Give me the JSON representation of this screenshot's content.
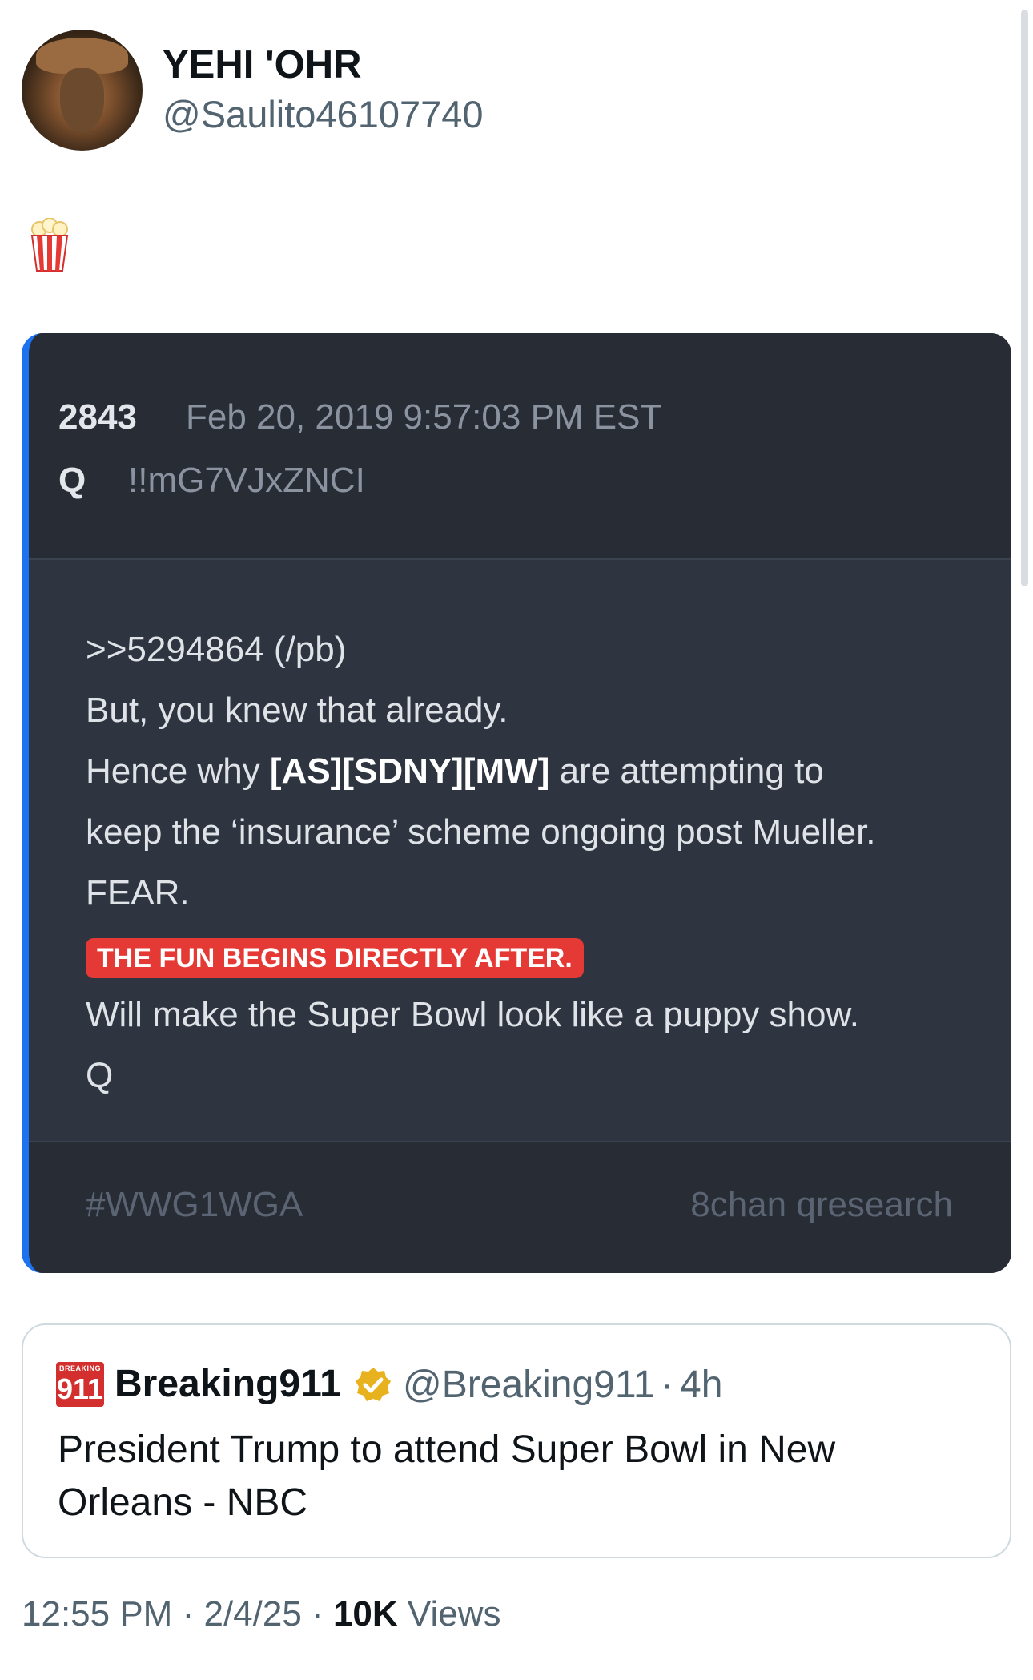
{
  "post": {
    "display_name": "YEHI 'OHR",
    "handle": "@Saulito46107740",
    "body_emoji": "popcorn"
  },
  "qcard": {
    "number": "2843",
    "date": "Feb 20, 2019 9:57:03 PM EST",
    "author": "Q",
    "tripcode": "!!mG7VJxZNCI",
    "lines": [
      ">>5294864 (/pb)",
      "But, you knew that already.",
      "Hence why ",
      "[AS][SDNY][MW]",
      " are attempting to",
      "keep the ‘insurance’ scheme ongoing post Mueller.",
      "FEAR.",
      "Will make the Super Bowl look like a puppy show.",
      "Q"
    ],
    "banner": "THE FUN BEGINS DIRECTLY AFTER.",
    "hashtag": "#WWG1WGA",
    "source": "8chan qresearch",
    "accent_color": "#1d72f0",
    "banner_color": "#e53935"
  },
  "quote": {
    "logo_top": "BREAKING",
    "logo_main": "911",
    "name": "Breaking911",
    "handle": "@Breaking911",
    "separator": "·",
    "time": "4h",
    "text": "President Trump to attend Super Bowl in New Orleans - NBC",
    "verified_badge_color": "#e8b21f"
  },
  "meta": {
    "time": "12:55 PM",
    "date": "2/4/25",
    "views_count": "10K",
    "views_label": "Views",
    "separator": "·"
  }
}
